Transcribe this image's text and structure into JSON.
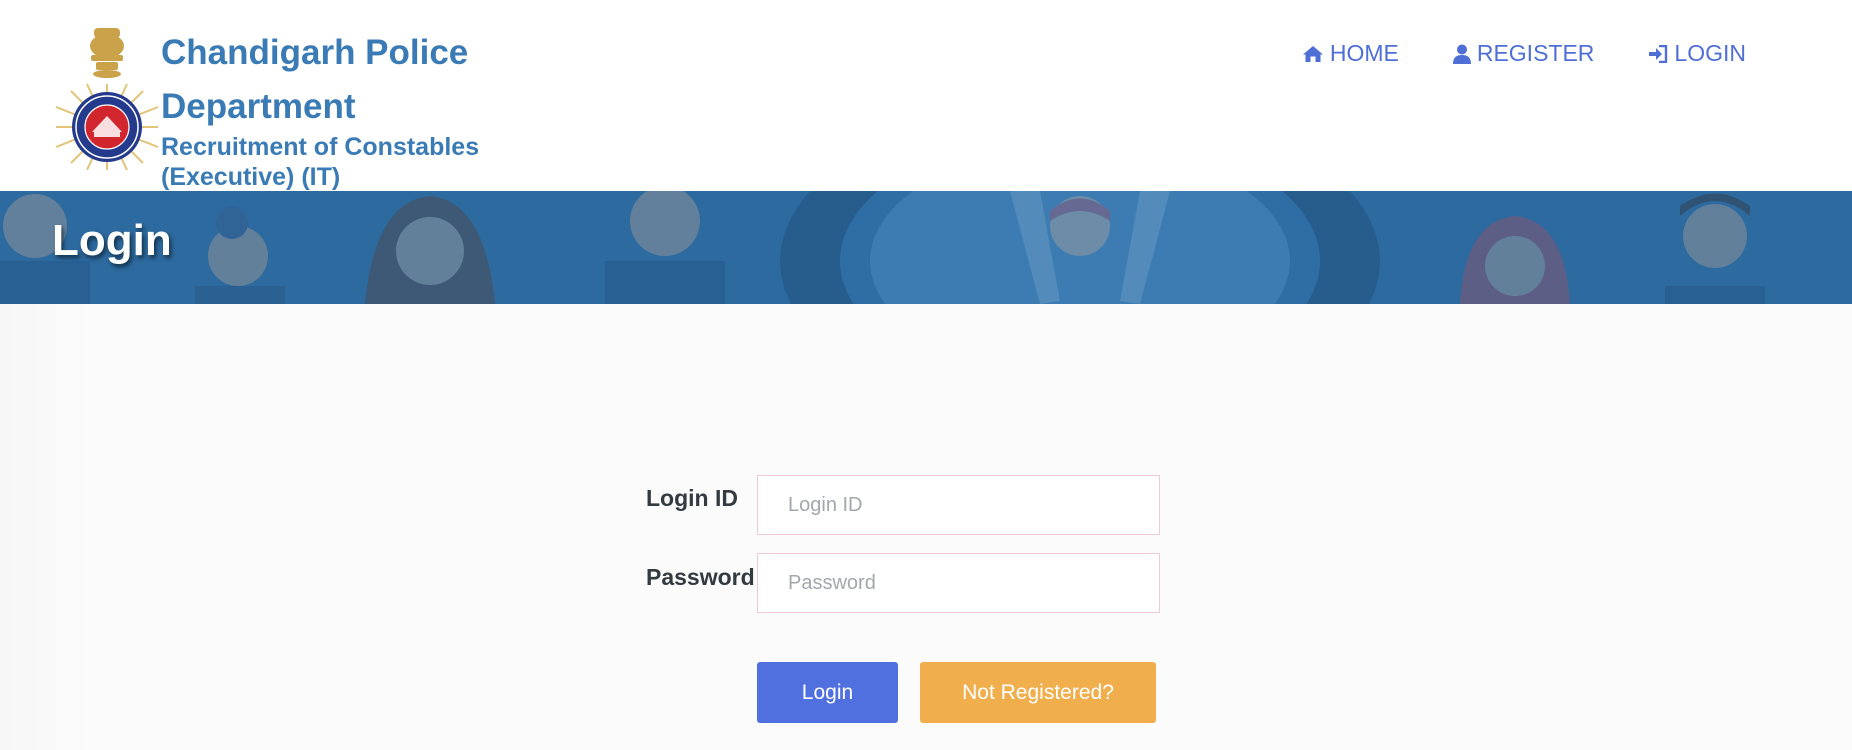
{
  "header": {
    "title": "Chandigarh Police Department",
    "subtitle": "Recruitment of Constables (Executive) (IT)",
    "logo_icon": "chandigarh-police-emblem-icon"
  },
  "nav": {
    "items": [
      {
        "label": "HOME",
        "icon": "home-icon"
      },
      {
        "label": "REGISTER",
        "icon": "user-icon"
      },
      {
        "label": "LOGIN",
        "icon": "sign-in-icon"
      }
    ]
  },
  "banner": {
    "title": "Login"
  },
  "form": {
    "login_id_label": "Login ID",
    "login_id_placeholder": "Login ID",
    "login_id_value": "",
    "password_label": "Password",
    "password_placeholder": "Password",
    "password_value": ""
  },
  "buttons": {
    "login": "Login",
    "not_registered": "Not Registered?"
  },
  "colors": {
    "brand_blue": "#3a7bb5",
    "nav_blue": "#4f6fd6",
    "banner_blue": "#2d6a9f",
    "login_button": "#5070e0",
    "register_button": "#f0ae4c"
  }
}
